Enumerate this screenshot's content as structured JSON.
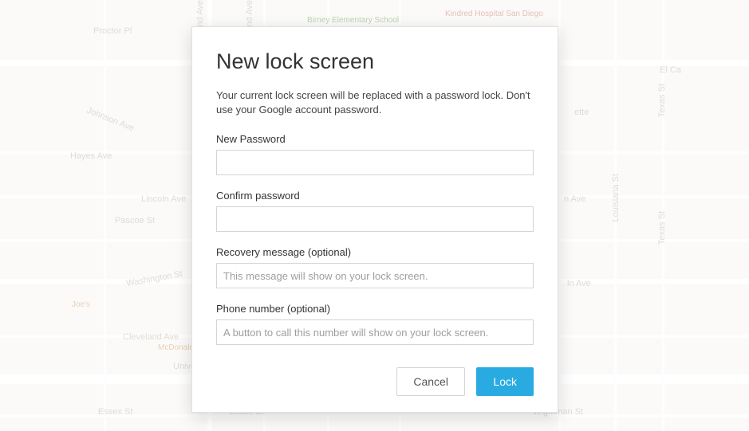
{
  "dialog": {
    "title": "New lock screen",
    "description": "Your current lock screen will be replaced with a password lock. Don't use your Google account password.",
    "fields": {
      "new_password": {
        "label": "New Password",
        "value": "",
        "placeholder": ""
      },
      "confirm_password": {
        "label": "Confirm password",
        "value": "",
        "placeholder": ""
      },
      "recovery_message": {
        "label": "Recovery message (optional)",
        "value": "",
        "placeholder": "This message will show on your lock screen."
      },
      "phone_number": {
        "label": "Phone number (optional)",
        "value": "",
        "placeholder": "A button to call this number will show on your lock screen."
      }
    },
    "buttons": {
      "cancel": "Cancel",
      "lock": "Lock"
    }
  },
  "map": {
    "streets": {
      "proctor_pl": "Proctor Pl",
      "johnson_ave": "Johnson Ave",
      "hayes_ave": "Hayes Ave",
      "lincoln_ave": "Lincoln Ave",
      "pascoe_st": "Pascoe St",
      "washington_st": "Washington St",
      "cleveland_ave": "Cleveland Ave",
      "university_ave": "University Ave",
      "essex_st_1": "Essex St",
      "essex_st_2": "Essex St",
      "wightman_st": "Wightman St",
      "eland_ave_1": "eland Ave",
      "eland_ave_2": "eland Ave",
      "texas_st": "Texas St",
      "louisiana_st": "Louisiana St",
      "el_ca": "El Ca",
      "ette": "ette",
      "n_ave": "n Ave",
      "ln_ave": "ln Ave"
    },
    "pois": {
      "birney": "Birney Elementary\nSchool",
      "kindred": "Kindred Hospital\nSan Diego",
      "joes": "Joe's",
      "mcdonald": "McDonald"
    }
  }
}
